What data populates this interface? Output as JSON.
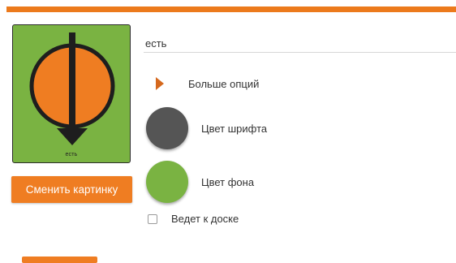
{
  "colors": {
    "accent": "#ec7a1c",
    "symbol_background": "#7ab342",
    "symbol_circle": "#ef7d22",
    "symbol_arrow": "#2b2b2b"
  },
  "symbol": {
    "caption": "есть",
    "icon": "down-arrow-through-circle-icon"
  },
  "change_image_button": {
    "label": "Сменить картинку"
  },
  "label_field": {
    "value": "есть"
  },
  "more_options": {
    "label": "Больше опций",
    "icon": "expand-triangle-icon"
  },
  "font_color": {
    "label": "Цвет шрифта",
    "color": "#555555"
  },
  "background_color": {
    "label": "Цвет фона",
    "color": "#7ab342"
  },
  "leads_to_board": {
    "label": "Ведет к доске",
    "checked": false
  }
}
